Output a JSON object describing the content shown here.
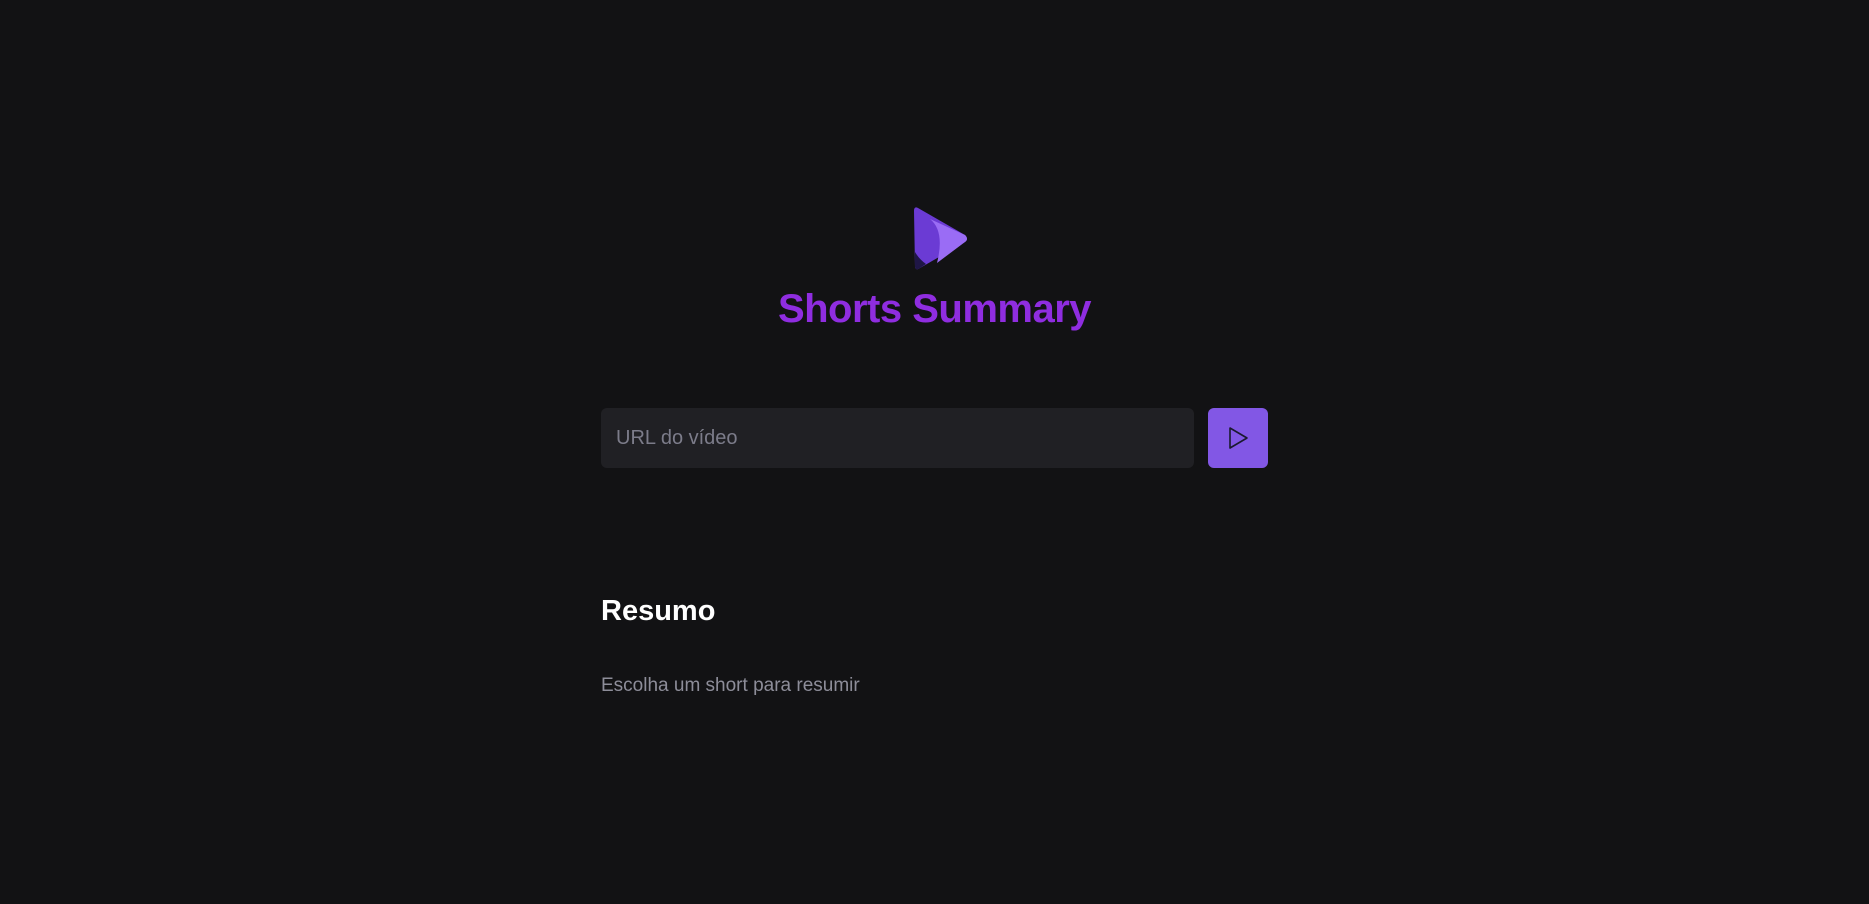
{
  "app": {
    "title": "Shorts Summary",
    "logo_icon": "play-triangle-logo-icon"
  },
  "form": {
    "url_placeholder": "URL do vídeo",
    "url_value": "",
    "submit_icon": "play-icon"
  },
  "summary": {
    "heading": "Resumo",
    "text": "Escolha um short para resumir"
  },
  "colors": {
    "background": "#121214",
    "input_background": "#202024",
    "accent": "#8257e5",
    "title": "#8f2de0",
    "heading": "#ffffff",
    "muted_text": "#8d8d99"
  }
}
